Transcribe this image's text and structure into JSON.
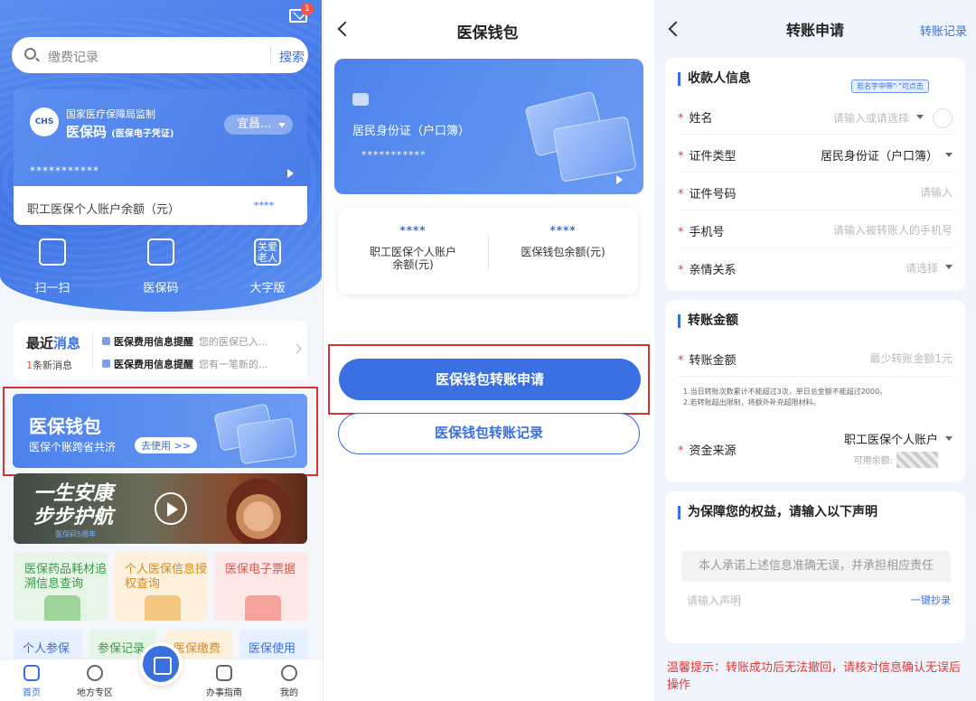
{
  "panel1": {
    "mail_badge": "1",
    "search_placeholder": "缴费记录",
    "search_button": "搜索",
    "card": {
      "authority": "国家医疗保障局监制",
      "title": "医保码",
      "title_note": "(医保电子凭证)",
      "city": "宜昌...",
      "number": "***********",
      "balance_label": "职工医保个人账户余额（元）",
      "balance_value": "****",
      "logo_text": "CHS"
    },
    "quick_actions": [
      {
        "label": "扫一扫",
        "icon": "scan-icon"
      },
      {
        "label": "医保码",
        "icon": "qr-code-icon"
      },
      {
        "label": "大字版",
        "icon": "elder-care-icon",
        "icon_text": "关爱\n老人"
      }
    ],
    "messages": {
      "title_a": "最近",
      "title_b": "消息",
      "count": "1",
      "count_suffix": "条新消息",
      "items": [
        {
          "title": "医保费用信息提醒",
          "text": "您的医保已入..."
        },
        {
          "title": "医保费用信息提醒",
          "text": "您有一笔新的..."
        }
      ]
    },
    "wallet_banner": {
      "title": "医保钱包",
      "subtitle": "医保个账跨省共济",
      "cta": "去使用 >>"
    },
    "promo": {
      "headline_1": "一生安康",
      "headline_2": "步步护航",
      "small": "医保码5周年"
    },
    "tiles": [
      {
        "label": "医保药品耗材追溯信息查询",
        "color": "#3a9a4a",
        "bg": "#e7f5e6"
      },
      {
        "label": "个人医保信息授权查询",
        "color": "#d98a1c",
        "bg": "#fdf1dd"
      },
      {
        "label": "医保电子票据",
        "color": "#e2534a",
        "bg": "#fde8e6"
      }
    ],
    "tiles_row2": [
      {
        "label": "个人参保",
        "color": "#3a6fe0",
        "bg": "#e6efff"
      },
      {
        "label": "参保记录",
        "color": "#3a9a4a",
        "bg": "#e7f5e6"
      },
      {
        "label": "医保缴费",
        "color": "#d98a1c",
        "bg": "#fdf1dd"
      },
      {
        "label": "医保使用",
        "color": "#3a6fe0",
        "bg": "#e6efff"
      }
    ],
    "tabbar": [
      {
        "label": "首页",
        "icon": "home-icon",
        "active": true
      },
      {
        "label": "地方专区",
        "icon": "local-zone-icon",
        "active": false
      },
      {
        "label": "办事指南",
        "icon": "guide-icon",
        "active": false
      },
      {
        "label": "我的",
        "icon": "profile-icon",
        "active": false
      }
    ]
  },
  "panel2": {
    "title": "医保钱包",
    "card_id_type": "居民身份证（户口簿）",
    "card_number": "***********",
    "balances": [
      {
        "value": "****",
        "label": "职工医保个人账户余额(元)"
      },
      {
        "value": "****",
        "label": "医保钱包余额(元)"
      }
    ],
    "primary_button": "医保钱包转账申请",
    "secondary_button": "医保钱包转账记录"
  },
  "panel3": {
    "title": "转账申请",
    "right_link": "转账记录",
    "payee_section": {
      "title": "收款人信息",
      "hint": "若名字中带\"·\"可点击",
      "rows": [
        {
          "label": "姓名",
          "value": "请输入或请选择"
        },
        {
          "label": "证件类型",
          "value": "居民身份证（户口簿）"
        },
        {
          "label": "证件号码",
          "value": "请输入"
        },
        {
          "label": "手机号",
          "value": "请输入被转账人的手机号"
        },
        {
          "label": "亲情关系",
          "value": "请选择"
        }
      ]
    },
    "amount_section": {
      "title": "转账金额",
      "amount_label": "转账金额",
      "amount_placeholder": "最少转账金额1元",
      "note_1": "1.当日转账次数累计不能超过3次，单日总金额不能超过2000。",
      "note_2": "2.若转账超出限制，将额外补充超限材料。",
      "source_label": "资金来源",
      "source_value": "职工医保个人账户",
      "available_label": "可用余额:"
    },
    "declaration_section": {
      "title": "为保障您的权益，请输入以下声明",
      "statement": "本人承诺上述信息准确无误，并承担相应责任",
      "input_placeholder": "请输入声明",
      "copy_button": "一键抄录"
    },
    "warning": "温馨提示：转账成功后无法撤回，请核对信息确认无误后操作"
  }
}
